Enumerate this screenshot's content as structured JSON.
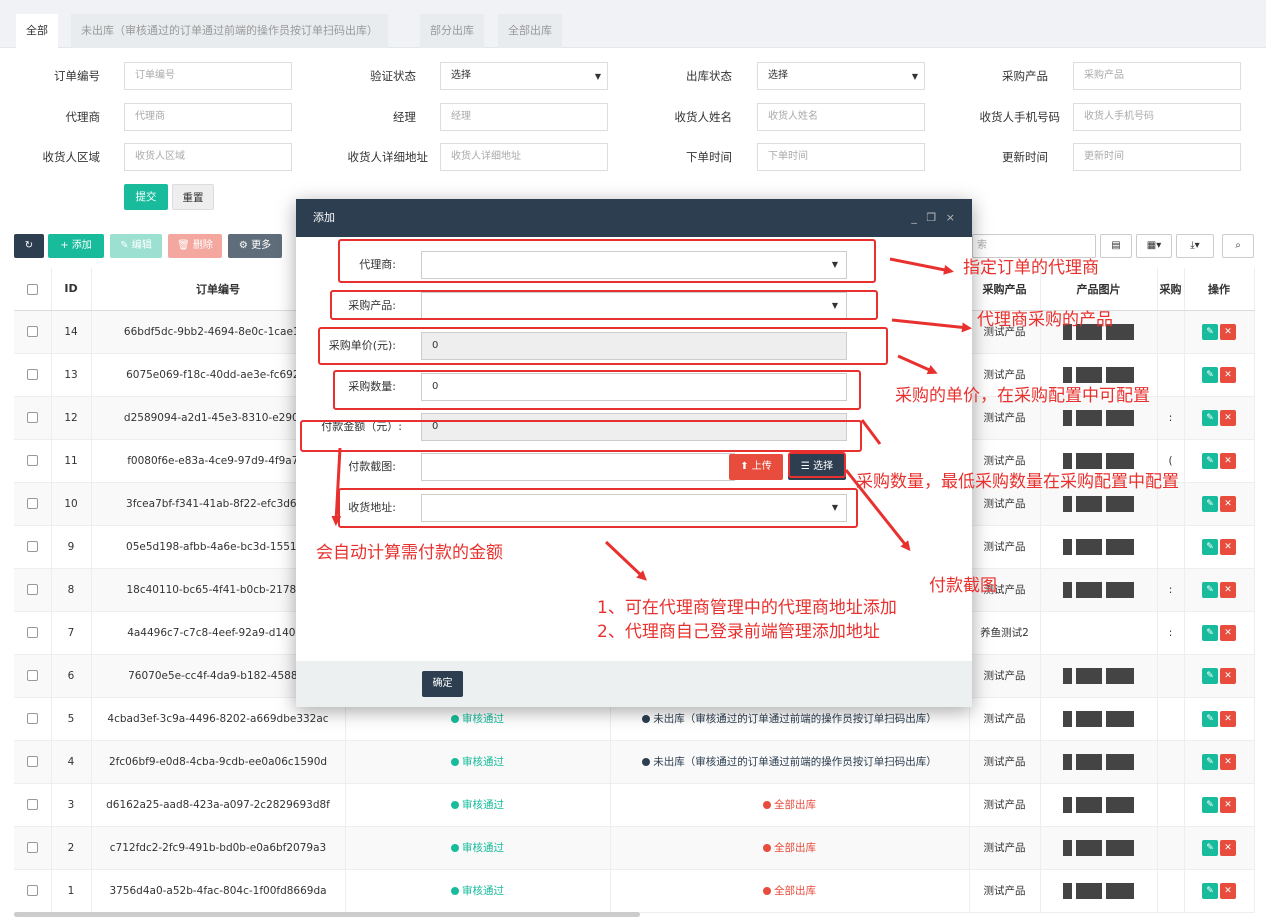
{
  "tabs": [
    "全部",
    "未出库（审核通过的订单通过前端的操作员按订单扫码出库）",
    "部分出库",
    "全部出库"
  ],
  "filters": [
    {
      "label": "订单编号",
      "placeholder": "订单编号"
    },
    {
      "label": "验证状态",
      "value": "选择"
    },
    {
      "label": "出库状态",
      "value": "选择"
    },
    {
      "label": "采购产品",
      "placeholder": "采购产品"
    },
    {
      "label": "代理商",
      "placeholder": "代理商"
    },
    {
      "label": "经理",
      "placeholder": "经理"
    },
    {
      "label": "收货人姓名",
      "placeholder": "收货人姓名"
    },
    {
      "label": "收货人手机号码",
      "placeholder": "收货人手机号码"
    },
    {
      "label": "收货人区域",
      "placeholder": "收货人区域"
    },
    {
      "label": "收货人详细地址",
      "placeholder": "收货人详细地址"
    },
    {
      "label": "下单时间",
      "placeholder": "下单时间"
    },
    {
      "label": "更新时间",
      "placeholder": "更新时间"
    }
  ],
  "form_buttons": {
    "submit": "提交",
    "reset": "重置"
  },
  "toolbar": {
    "refresh": "↻",
    "add": "+ 添加",
    "edit": "✎ 编辑",
    "delete": "🗑 删除",
    "more": "⚙ 更多",
    "search_placeholder": "索"
  },
  "table": {
    "headers": [
      "ID",
      "订单编号",
      "",
      "",
      "采购产品",
      "产品图片",
      "采购",
      "操作"
    ],
    "status_approved": "审核通过",
    "out_none": "未出库（审核通过的订单通过前端的操作员按订单扫码出库）",
    "out_all": "全部出库",
    "rows": [
      {
        "id": "14",
        "order": "66bdf5dc-9bb2-4694-8e0c-1cae15c",
        "product": "测试产品",
        "extra": ""
      },
      {
        "id": "13",
        "order": "6075e069-f18c-40dd-ae3e-fc6928f",
        "product": "测试产品",
        "extra": ""
      },
      {
        "id": "12",
        "order": "d2589094-a2d1-45e3-8310-e29022",
        "product": "测试产品",
        "extra": ":"
      },
      {
        "id": "11",
        "order": "f0080f6e-e83a-4ce9-97d9-4f9a7f9",
        "product": "测试产品",
        "extra": "("
      },
      {
        "id": "10",
        "order": "3fcea7bf-f341-41ab-8f22-efc3d653",
        "product": "测试产品",
        "extra": ""
      },
      {
        "id": "9",
        "order": "05e5d198-afbb-4a6e-bc3d-1551d1",
        "product": "测试产品",
        "extra": ""
      },
      {
        "id": "8",
        "order": "18c40110-bc65-4f41-b0cb-217860",
        "product": "测试产品",
        "extra": ":"
      },
      {
        "id": "7",
        "order": "4a4496c7-c7c8-4eef-92a9-d14064",
        "product": "养鱼测试2",
        "extra": ":"
      },
      {
        "id": "6",
        "order": "76070e5e-cc4f-4da9-b182-45881f",
        "product": "测试产品",
        "extra": ""
      },
      {
        "id": "5",
        "order": "4cbad3ef-3c9a-4496-8202-a669dbe332ac",
        "product": "测试产品",
        "extra": ""
      },
      {
        "id": "4",
        "order": "2fc06bf9-e0d8-4cba-9cdb-ee0a06c1590d",
        "product": "测试产品",
        "extra": ""
      },
      {
        "id": "3",
        "order": "d6162a25-aad8-423a-a097-2c2829693d8f",
        "product": "测试产品",
        "extra": ""
      },
      {
        "id": "2",
        "order": "c712fdc2-2fc9-491b-bd0b-e0a6bf2079a3",
        "product": "测试产品",
        "extra": ""
      },
      {
        "id": "1",
        "order": "3756d4a0-a52b-4fac-804c-1f00fd8669da",
        "product": "测试产品",
        "extra": ""
      }
    ]
  },
  "modal": {
    "title": "添加",
    "controls": "_ ❐ ×",
    "fields": [
      {
        "label": "代理商:",
        "value": ""
      },
      {
        "label": "采购产品:",
        "value": ""
      },
      {
        "label": "采购单价(元):",
        "value": "0"
      },
      {
        "label": "采购数量:",
        "value": "0"
      },
      {
        "label": "付款金额（元）:",
        "value": "0"
      },
      {
        "label": "付款截图:",
        "value": ""
      },
      {
        "label": "收货地址:",
        "value": ""
      }
    ],
    "upload": "⬆ 上传",
    "choose": "☰ 选择",
    "ok": "确定"
  },
  "annotations": {
    "agent": "指定订单的代理商",
    "product": "代理商采购的产品",
    "price": "采购的单价，在采购配置中可配置",
    "qty": "采购数量，最低采购数量在采购配置中配置",
    "amount": "会自动计算需付款的金额",
    "screenshot": "付款截图",
    "address1": "1、可在代理商管理中的代理商地址添加",
    "address2": "2、代理商自己登录前端管理添加地址"
  },
  "colors": {
    "navy": "#2c3e50",
    "green": "#18bc9c",
    "red": "#e74c3c",
    "annotation": "#e8312e"
  }
}
